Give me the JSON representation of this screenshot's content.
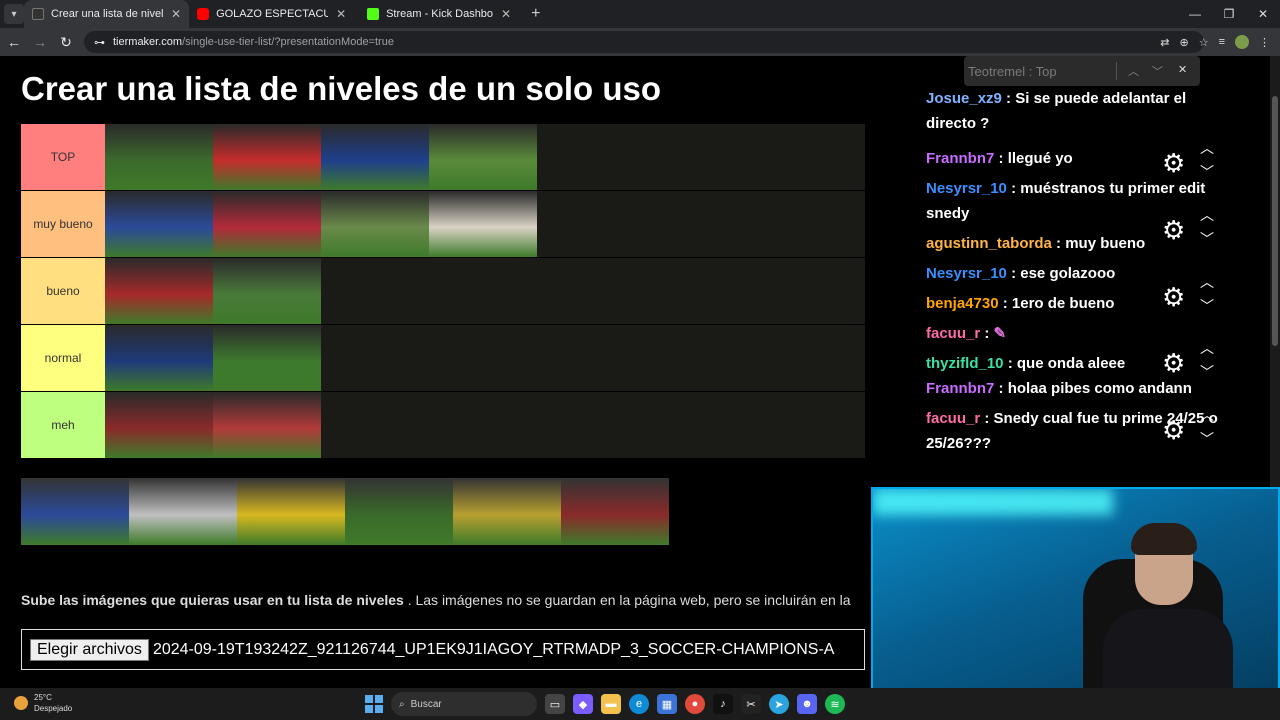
{
  "browser": {
    "tabs": [
      {
        "title": "Crear una lista de niveles de un",
        "favicon_color": "#333333",
        "active": true
      },
      {
        "title": "GOLAZO ESPECTACULAR de LA",
        "favicon_color": "#ff0000",
        "active": false
      },
      {
        "title": "Stream - Kick Dashboard",
        "favicon_color": "#53fc18",
        "active": false
      }
    ],
    "new_tab_symbol": "+",
    "url_host": "tiermaker.com",
    "url_path": "/single-use-tier-list/?presentationMode=true"
  },
  "page": {
    "title": "Crear una lista de niveles de un solo uso",
    "tiers": [
      {
        "label": "TOP",
        "color": "#ff7f7f",
        "items": 4
      },
      {
        "label": "muy bueno",
        "color": "#ffbf7f",
        "items": 4
      },
      {
        "label": "bueno",
        "color": "#ffdf7f",
        "items": 2
      },
      {
        "label": "normal",
        "color": "#ffff7f",
        "items": 2
      },
      {
        "label": "meh",
        "color": "#bfff7f",
        "items": 2
      }
    ],
    "pool_items": 6,
    "upload_bold": "Sube las imágenes que quieras usar en tu lista de niveles",
    "upload_rest": ". Las imágenes no se guardan en la página web, pero se incluirán en la",
    "file_button": "Elegir archivos",
    "file_name": "2024-09-19T193242Z_921126744_UP1EK9J1IAGOY_RTRMADP_3_SOCCER-CHAMPIONS-A"
  },
  "chat": {
    "find_text": "Teotremel : Top",
    "messages": [
      {
        "user": "Josue_xz9",
        "color": "#7fb2ff",
        "text": "Si se puede adelantar el directo ?"
      },
      {
        "user": "Frannbn7",
        "color": "#c86bff",
        "text": "llegué yo"
      },
      {
        "user": "Nesyrsr_10",
        "color": "#3a8fff",
        "text": "muéstranos tu primer edit snedy"
      },
      {
        "user": "agustinn_taborda",
        "color": "#ffb347",
        "text": "muy bueno"
      },
      {
        "user": "Nesyrsr_10",
        "color": "#3a8fff",
        "text": "ese golazooo"
      },
      {
        "user": "benja4730",
        "color": "#ffa500",
        "text": "1ero de bueno"
      },
      {
        "user": "facuu_r",
        "color": "#ff6ba8",
        "text": ""
      },
      {
        "user": "thyzifld_10",
        "color": "#3de0a0",
        "text": "que onda aleee"
      },
      {
        "user": "Frannbn7",
        "color": "#c86bff",
        "text": "holaa pibes como andann"
      },
      {
        "user": "facuu_r",
        "color": "#ff6ba8",
        "text": "Snedy cual fue tu prime 24/25 o 25/26???"
      }
    ]
  },
  "taskbar": {
    "temperature": "25°C",
    "weather": "Despejado",
    "search_placeholder": "Buscar"
  },
  "icons": [
    "tab-menu-icon",
    "close-icon",
    "back-icon",
    "forward-icon",
    "reload-icon",
    "site-info-icon",
    "translate-icon",
    "zoom-icon",
    "star-icon",
    "gear-icon",
    "chevron-up-icon",
    "chevron-down-icon",
    "windows-icon",
    "search-icon"
  ]
}
